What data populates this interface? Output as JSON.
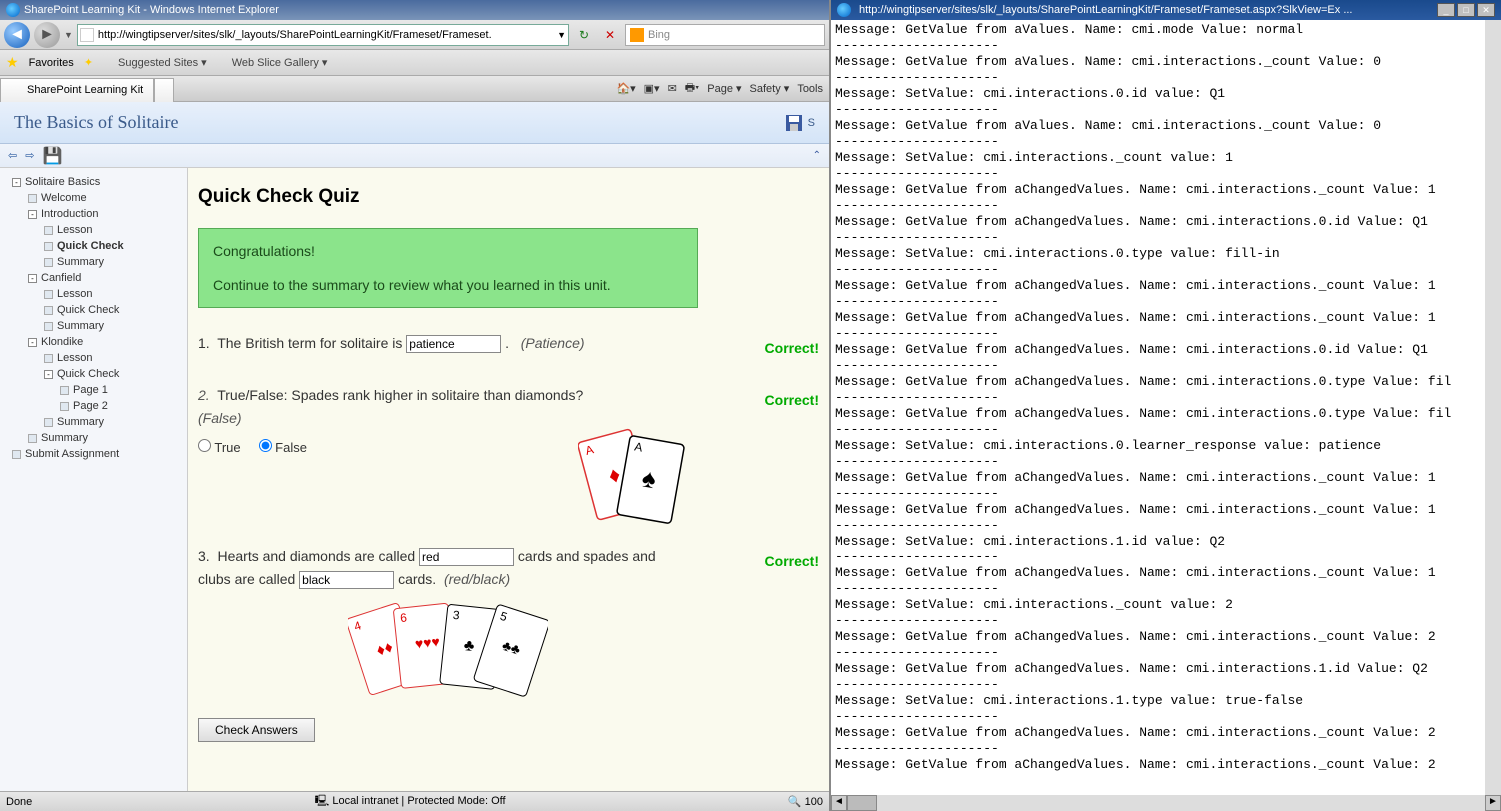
{
  "leftWindow": {
    "title": "SharePoint Learning Kit - Windows Internet Explorer",
    "addressUrl": "http://wingtipserver/sites/slk/_layouts/SharePointLearningKit/Frameset/Frameset.",
    "searchPlaceholder": "Bing",
    "favoritesLabel": "Favorites",
    "suggestedSites": "Suggested Sites",
    "webSliceGallery": "Web Slice Gallery",
    "tabLabel": "SharePoint Learning Kit",
    "toolbarItems": {
      "page": "Page",
      "safety": "Safety",
      "tools": "Tools"
    },
    "contentTitle": "The Basics of Solitaire",
    "saveLinkChar": "S",
    "tree": {
      "root": "Solitaire Basics",
      "welcome": "Welcome",
      "introduction": "Introduction",
      "introLesson": "Lesson",
      "introQuickCheck": "Quick Check",
      "introSummary": "Summary",
      "canfield": "Canfield",
      "canLesson": "Lesson",
      "canQuickCheck": "Quick Check",
      "canSummary": "Summary",
      "klondike": "Klondike",
      "klonLesson": "Lesson",
      "klonQuickCheck": "Quick Check",
      "klonPage1": "Page 1",
      "klonPage2": "Page 2",
      "klonSummary": "Summary",
      "summary": "Summary",
      "submit": "Submit Assignment"
    },
    "quiz": {
      "title": "Quick Check Quiz",
      "congrats1": "Congratulations!",
      "congrats2": "Continue to the summary to review what you learned in this unit.",
      "q1num": "1.",
      "q1text": "The British term for solitaire is",
      "q1suffix": ".",
      "q1answer": "patience",
      "q1hint": "(Patience)",
      "q2num": "2.",
      "q2text": "True/False: Spades rank higher in solitaire than diamonds?",
      "q2hint": "(False)",
      "q2true": "True",
      "q2false": "False",
      "q3num": "3.",
      "q3textA": "Hearts and diamonds are called",
      "q3ans1": "red",
      "q3textB": "cards and spades and clubs are called",
      "q3ans2": "black",
      "q3textC": "cards.",
      "q3hint": "(red/black)",
      "correctLabel": "Correct!",
      "checkBtn": "Check Answers"
    },
    "statusBar": {
      "done": "Done",
      "zone": "Local intranet | Protected Mode: Off",
      "zoom": "100"
    }
  },
  "rightWindow": {
    "title": "http://wingtipserver/sites/slk/_layouts/SharePointLearningKit/Frameset/Frameset.aspx?SlkView=Ex ...",
    "logLines": [
      "Message: GetValue from aValues. Name: cmi.mode Value: normal",
      "---------------------",
      "Message: GetValue from aValues. Name: cmi.interactions._count Value: 0",
      "---------------------",
      "Message: SetValue: cmi.interactions.0.id value: Q1",
      "---------------------",
      "Message: GetValue from aValues. Name: cmi.interactions._count Value: 0",
      "---------------------",
      "Message: SetValue: cmi.interactions._count value: 1",
      "---------------------",
      "Message: GetValue from aChangedValues. Name: cmi.interactions._count Value: 1",
      "---------------------",
      "Message: GetValue from aChangedValues. Name: cmi.interactions.0.id Value: Q1",
      "---------------------",
      "Message: SetValue: cmi.interactions.0.type value: fill-in",
      "---------------------",
      "Message: GetValue from aChangedValues. Name: cmi.interactions._count Value: 1",
      "---------------------",
      "Message: GetValue from aChangedValues. Name: cmi.interactions._count Value: 1",
      "---------------------",
      "Message: GetValue from aChangedValues. Name: cmi.interactions.0.id Value: Q1",
      "---------------------",
      "Message: GetValue from aChangedValues. Name: cmi.interactions.0.type Value: fil",
      "---------------------",
      "Message: GetValue from aChangedValues. Name: cmi.interactions.0.type Value: fil",
      "---------------------",
      "Message: SetValue: cmi.interactions.0.learner_response value: patience",
      "---------------------",
      "Message: GetValue from aChangedValues. Name: cmi.interactions._count Value: 1",
      "---------------------",
      "Message: GetValue from aChangedValues. Name: cmi.interactions._count Value: 1",
      "---------------------",
      "Message: SetValue: cmi.interactions.1.id value: Q2",
      "---------------------",
      "Message: GetValue from aChangedValues. Name: cmi.interactions._count Value: 1",
      "---------------------",
      "Message: SetValue: cmi.interactions._count value: 2",
      "---------------------",
      "Message: GetValue from aChangedValues. Name: cmi.interactions._count Value: 2",
      "---------------------",
      "Message: GetValue from aChangedValues. Name: cmi.interactions.1.id Value: Q2",
      "---------------------",
      "Message: SetValue: cmi.interactions.1.type value: true-false",
      "---------------------",
      "Message: GetValue from aChangedValues. Name: cmi.interactions._count Value: 2",
      "---------------------",
      "Message: GetValue from aChangedValues. Name: cmi.interactions._count Value: 2"
    ]
  }
}
